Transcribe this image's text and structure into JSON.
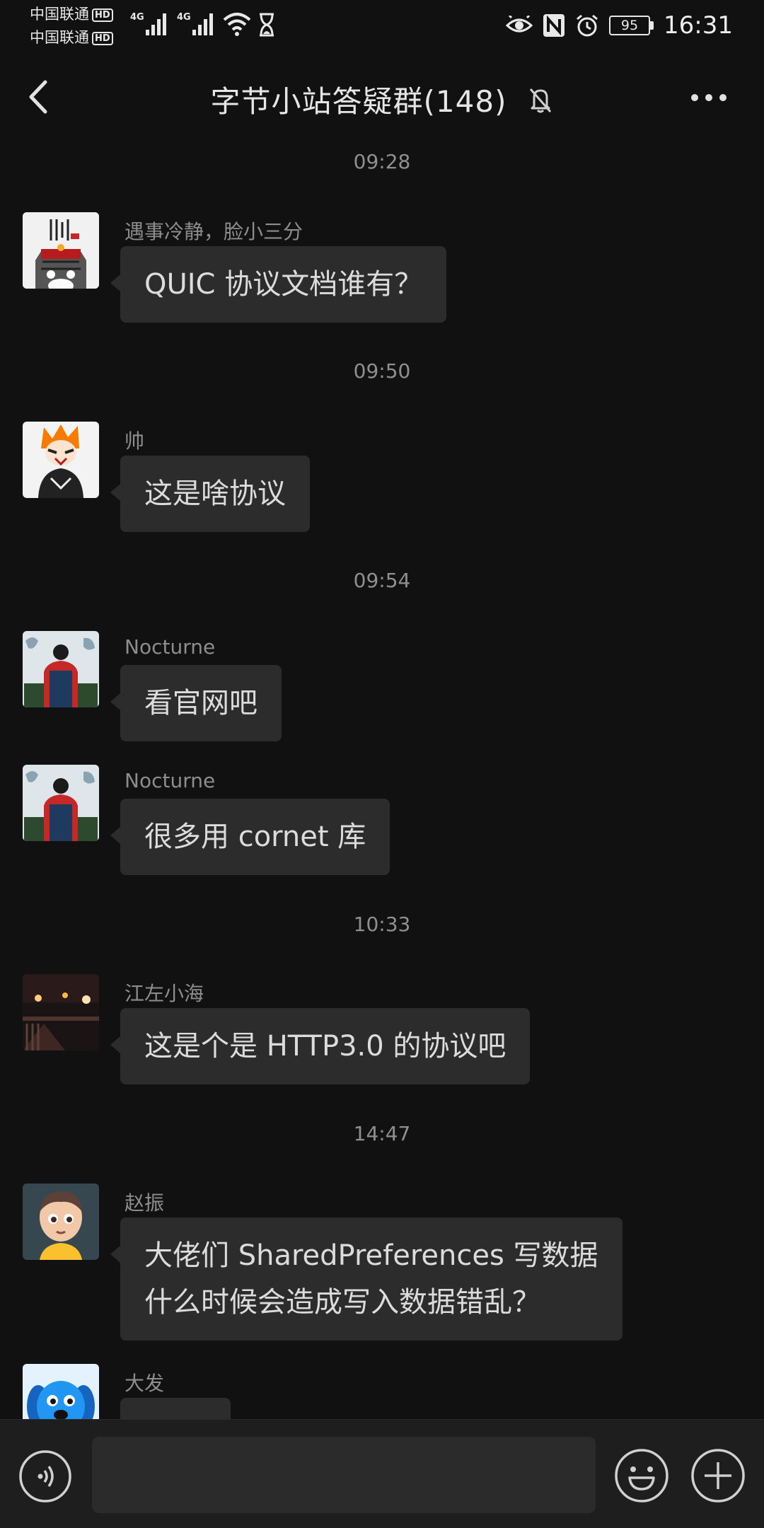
{
  "status_bar": {
    "carrier1": "中国联通",
    "carrier2": "中国联通",
    "hd": "HD",
    "net1": "4G",
    "net2": "4G",
    "battery": "95",
    "time": "16:31"
  },
  "header": {
    "title": "字节小站答疑群(148)"
  },
  "messages": [
    {
      "time": "09:28",
      "sender": "遇事冷静，脸小三分",
      "lines": [
        "QUIC 协议文档谁有？"
      ]
    },
    {
      "time": "09:50",
      "sender": "帅",
      "lines": [
        "这是啥协议"
      ]
    },
    {
      "time": "09:54",
      "sender": "Nocturne",
      "lines": [
        "看官网吧"
      ]
    },
    {
      "sender": "Nocturne",
      "lines": [
        "很多用 cornet 库"
      ]
    },
    {
      "time": "10:33",
      "sender": "江左小海",
      "lines": [
        "这是个是 HTTP3.0 的协议吧"
      ]
    },
    {
      "time": "14:47",
      "sender": "赵振",
      "lines": [
        "大佬们 SharedPreferences 写数据",
        "什么时候会造成写入数据错乱？"
      ]
    },
    {
      "sender": "大发",
      "lines": [
        ""
      ]
    }
  ],
  "input": {
    "value": "",
    "placeholder": ""
  }
}
